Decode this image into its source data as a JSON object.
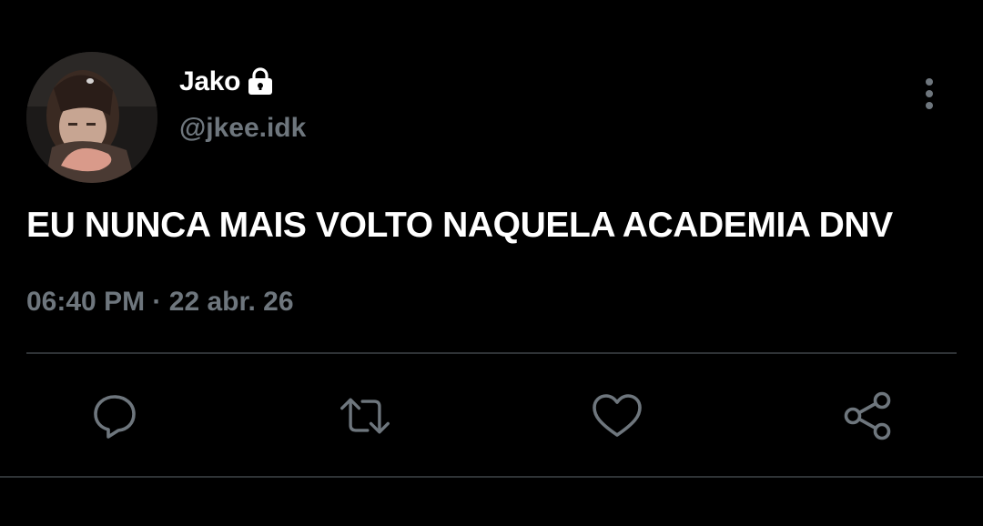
{
  "user": {
    "display_name": "Jako",
    "handle": "@jkee.idk",
    "protected_icon": "lock-icon",
    "avatar": "profile-photo"
  },
  "tweet": {
    "text": "EU NUNCA MAIS VOLTO NAQUELA ACADEMIA DNV",
    "time": "06:40 PM",
    "separator": "·",
    "date": "22 abr. 26"
  },
  "actions": [
    {
      "icon": "reply-icon"
    },
    {
      "icon": "retweet-icon"
    },
    {
      "icon": "like-icon"
    },
    {
      "icon": "share-icon"
    }
  ],
  "menu": {
    "icon": "more-options-icon"
  },
  "colors": {
    "background": "#000000",
    "primary_text": "#ffffff",
    "secondary_text": "#6e767d",
    "divider": "#2f3336"
  }
}
